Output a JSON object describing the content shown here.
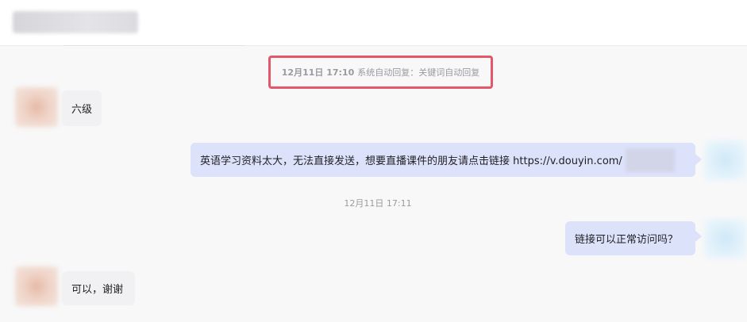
{
  "system_notice": {
    "time": "12月11日 17:10",
    "text": "系统自动回复：关键词自动回复"
  },
  "divider_time": "12月11日 17:11",
  "messages": [
    {
      "side": "left",
      "text": "六级"
    },
    {
      "side": "right",
      "text": "英语学习资料太大，无法直接发送，想要直播课件的朋友请点击链接 https://v.douyin.com/"
    },
    {
      "side": "right",
      "text": "链接可以正常访问吗？"
    },
    {
      "side": "left",
      "text": "可以，谢谢"
    }
  ],
  "colors": {
    "highlight_border": "#e4576a",
    "agent_bubble": "#dde2fb",
    "user_bubble": "#f1f1f3",
    "background": "#f8f8f9"
  }
}
